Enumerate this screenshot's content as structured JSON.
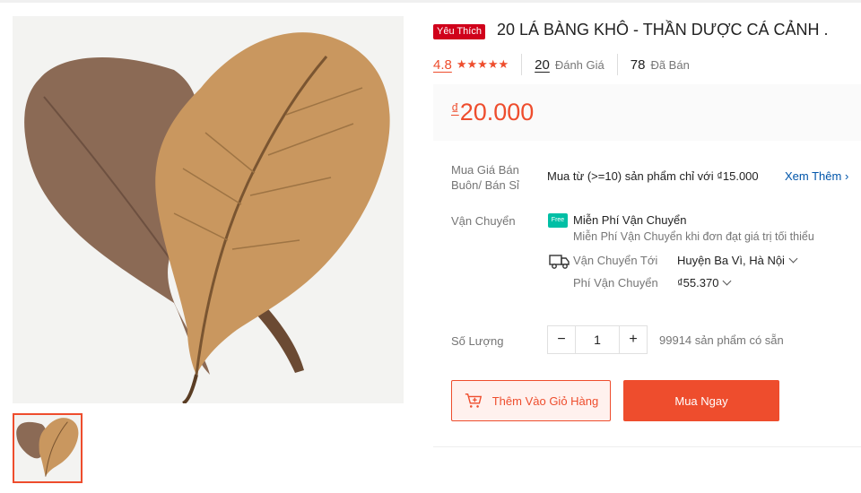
{
  "product": {
    "favorite_badge": "Yêu Thích",
    "title": "20 LÁ BÀNG KHÔ - THẦN DƯỢC CÁ CẢNH .",
    "rating": "4.8",
    "rating_value": 4.8,
    "reviews_count": "20",
    "reviews_label": "Đánh Giá",
    "sold_count": "78",
    "sold_label": "Đã Bán",
    "currency": "₫",
    "price": "20.000"
  },
  "wholesale": {
    "label": "Mua Giá Bán Buôn/ Bán Sỉ",
    "text": "Mua từ (>=10) sản phẩm chỉ với ₫15.000",
    "see_more": "Xem Thêm"
  },
  "shipping": {
    "label": "Vận Chuyển",
    "free_icon_text": "Free",
    "free_title": "Miễn Phí Vận Chuyển",
    "free_subtitle": "Miễn Phí Vận Chuyển khi đơn đạt giá trị tối thiểu",
    "ship_to_label": "Vận Chuyển Tới",
    "ship_to_value": "Huyện Ba Vì, Hà Nội",
    "fee_label": "Phí Vận Chuyển",
    "fee_value": "₫55.370"
  },
  "quantity": {
    "label": "Số Lượng",
    "minus": "−",
    "value": "1",
    "plus": "+",
    "stock_text": "99914 sản phẩm có sẵn"
  },
  "actions": {
    "add_to_cart": "Thêm Vào Giỏ Hàng",
    "buy_now": "Mua Ngay"
  },
  "colors": {
    "accent": "#ee4d2d",
    "favorite_badge": "#d0011b",
    "free_ship": "#00bfa5",
    "link": "#0055aa"
  },
  "icons": [
    "star-icon",
    "free-shipping-icon",
    "truck-icon",
    "chevron-down-icon",
    "cart-add-icon"
  ]
}
